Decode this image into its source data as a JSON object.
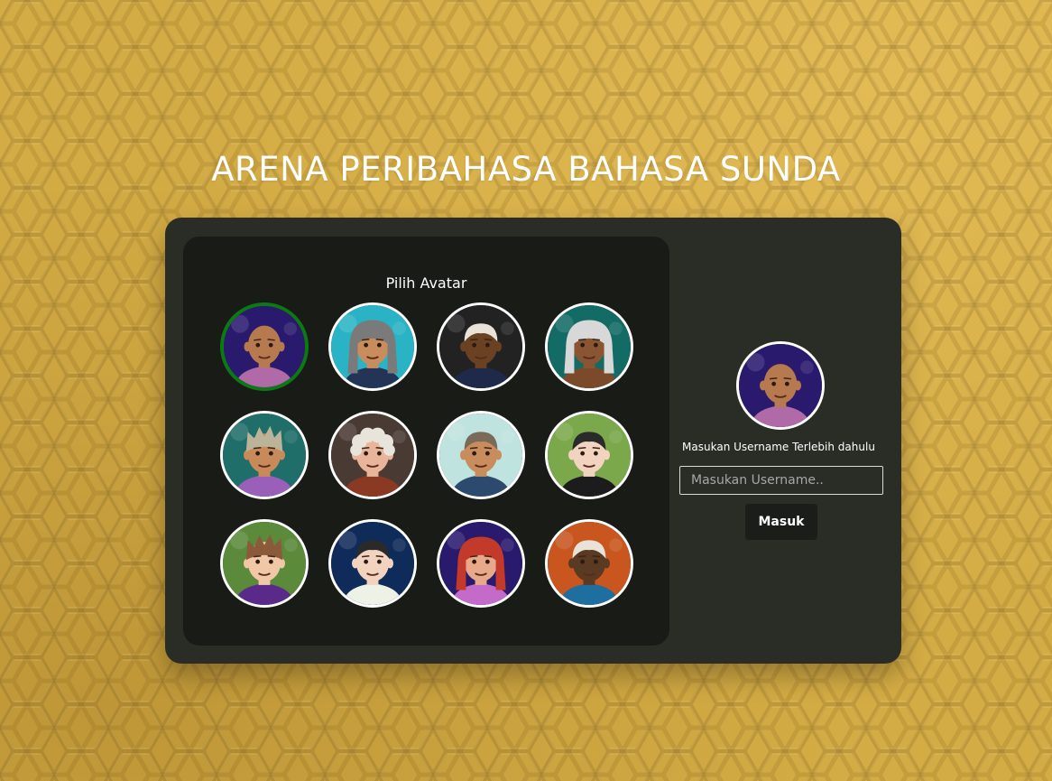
{
  "page": {
    "title": "ARENA PERIBAHASA BAHASA SUNDA"
  },
  "avatar_panel": {
    "title": "Pilih Avatar",
    "avatars": [
      {
        "icon": "avatar-bald-space-icon",
        "bg": "#2a1a6e",
        "skin": "#b77a4f",
        "hair": "none",
        "hair_color": "#b77a4f",
        "shirt": "#b06aa8",
        "selected": true
      },
      {
        "icon": "avatar-long-hair-blue-icon",
        "bg": "#2ab3c4",
        "skin": "#c98c5c",
        "hair": "long",
        "hair_color": "#7a7a7a",
        "shirt": "#233457",
        "selected": false
      },
      {
        "icon": "avatar-suit-icon",
        "bg": "#222222",
        "skin": "#6a4122",
        "hair": "short",
        "hair_color": "#e8e2d8",
        "shirt": "#1f2a4a",
        "selected": false
      },
      {
        "icon": "avatar-silver-hair-icon",
        "bg": "#136b66",
        "skin": "#8a5533",
        "hair": "long",
        "hair_color": "#d8d8d8",
        "shirt": "#7a4a2a",
        "selected": false
      },
      {
        "icon": "avatar-spiky-hair-icon",
        "bg": "#1f6e6a",
        "skin": "#c98a5a",
        "hair": "spiky",
        "hair_color": "#bbb49a",
        "shirt": "#9a5fb8",
        "selected": false
      },
      {
        "icon": "avatar-pink-glasses-icon",
        "bg": "#4a3a34",
        "skin": "#e8b49a",
        "hair": "curly",
        "hair_color": "#e8e4dc",
        "shirt": "#8a3a22",
        "selected": false
      },
      {
        "icon": "avatar-blue-glasses-icon",
        "bg": "#bfe3df",
        "skin": "#c98c5c",
        "hair": "short",
        "hair_color": "#7a6a5a",
        "shirt": "#2b4a6e",
        "selected": false
      },
      {
        "icon": "avatar-sunglasses-icon",
        "bg": "#7aa84a",
        "skin": "#f1d3bf",
        "hair": "short",
        "hair_color": "#2a2a2a",
        "shirt": "#1c1c1c",
        "selected": false
      },
      {
        "icon": "avatar-jungle-icon",
        "bg": "#5a8a3a",
        "skin": "#f0c8a8",
        "hair": "spiky",
        "hair_color": "#8a5a3a",
        "shirt": "#5a2a8a",
        "selected": false
      },
      {
        "icon": "avatar-fur-collar-icon",
        "bg": "#0f2b5a",
        "skin": "#f1d3bf",
        "hair": "short",
        "hair_color": "#2a2a2a",
        "shirt": "#eef2e6",
        "selected": false
      },
      {
        "icon": "avatar-red-hair-icon",
        "bg": "#2a1a6e",
        "skin": "#e8a88a",
        "hair": "long",
        "hair_color": "#c43a2a",
        "shirt": "#c46ac8",
        "selected": false
      },
      {
        "icon": "avatar-round-glasses-icon",
        "bg": "#c8561e",
        "skin": "#5a3a22",
        "hair": "short",
        "hair_color": "#e8e2d8",
        "shirt": "#1e6ea0",
        "selected": false
      }
    ]
  },
  "login": {
    "preview_icon": "avatar-bald-space-icon",
    "prompt": "Masukan Username Terlebih dahulu",
    "username_placeholder": "Masukan Username..",
    "username_value": "",
    "submit_label": "Masuk"
  },
  "colors": {
    "background": "#d4ac45",
    "card": "#2a2c26",
    "panel": "#191b17",
    "selected_ring": "#0c7a12",
    "button": "#1b1d19"
  }
}
